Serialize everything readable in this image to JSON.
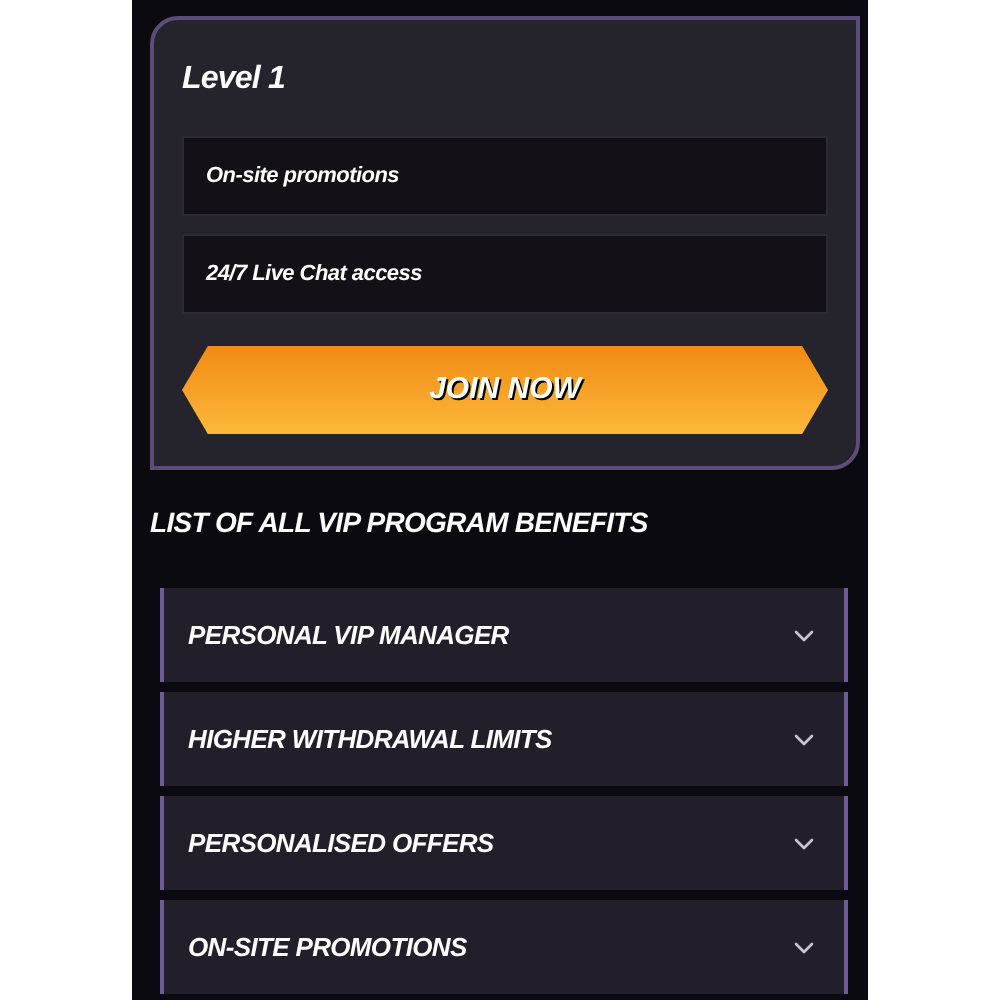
{
  "level_card": {
    "title": "Level 1",
    "perks": [
      "On-site promotions",
      "24/7 Live Chat access"
    ],
    "button": "JOIN NOW"
  },
  "benefits": {
    "heading": "LIST OF ALL VIP PROGRAM BENEFITS",
    "items": [
      {
        "label": "PERSONAL VIP MANAGER",
        "expanded": false
      },
      {
        "label": "HIGHER WITHDRAWAL LIMITS",
        "expanded": false
      },
      {
        "label": "PERSONALISED OFFERS",
        "expanded": false
      },
      {
        "label": "ON-SITE PROMOTIONS",
        "expanded": false
      }
    ]
  }
}
